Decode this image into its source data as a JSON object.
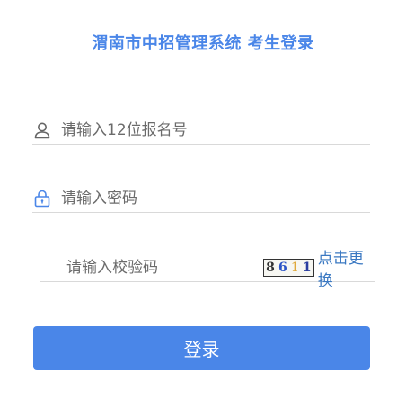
{
  "header": {
    "title": "渭南市中招管理系统 考生登录"
  },
  "form": {
    "username_placeholder": "请输入12位报名号",
    "username_value": "",
    "password_placeholder": "请输入密码",
    "password_value": "",
    "captcha_placeholder": "请输入校验码",
    "captcha_value": "",
    "captcha_chars": [
      "8",
      "6",
      "1",
      "1"
    ],
    "refresh_label": "点击更换",
    "login_label": "登录"
  },
  "icons": {
    "user": "user-icon",
    "lock": "lock-icon"
  },
  "colors": {
    "accent": "#4a86e8",
    "link": "#3a78c2",
    "lock_icon": "#4a86e8",
    "user_icon": "#666666",
    "underline": "#d9d9d9"
  }
}
